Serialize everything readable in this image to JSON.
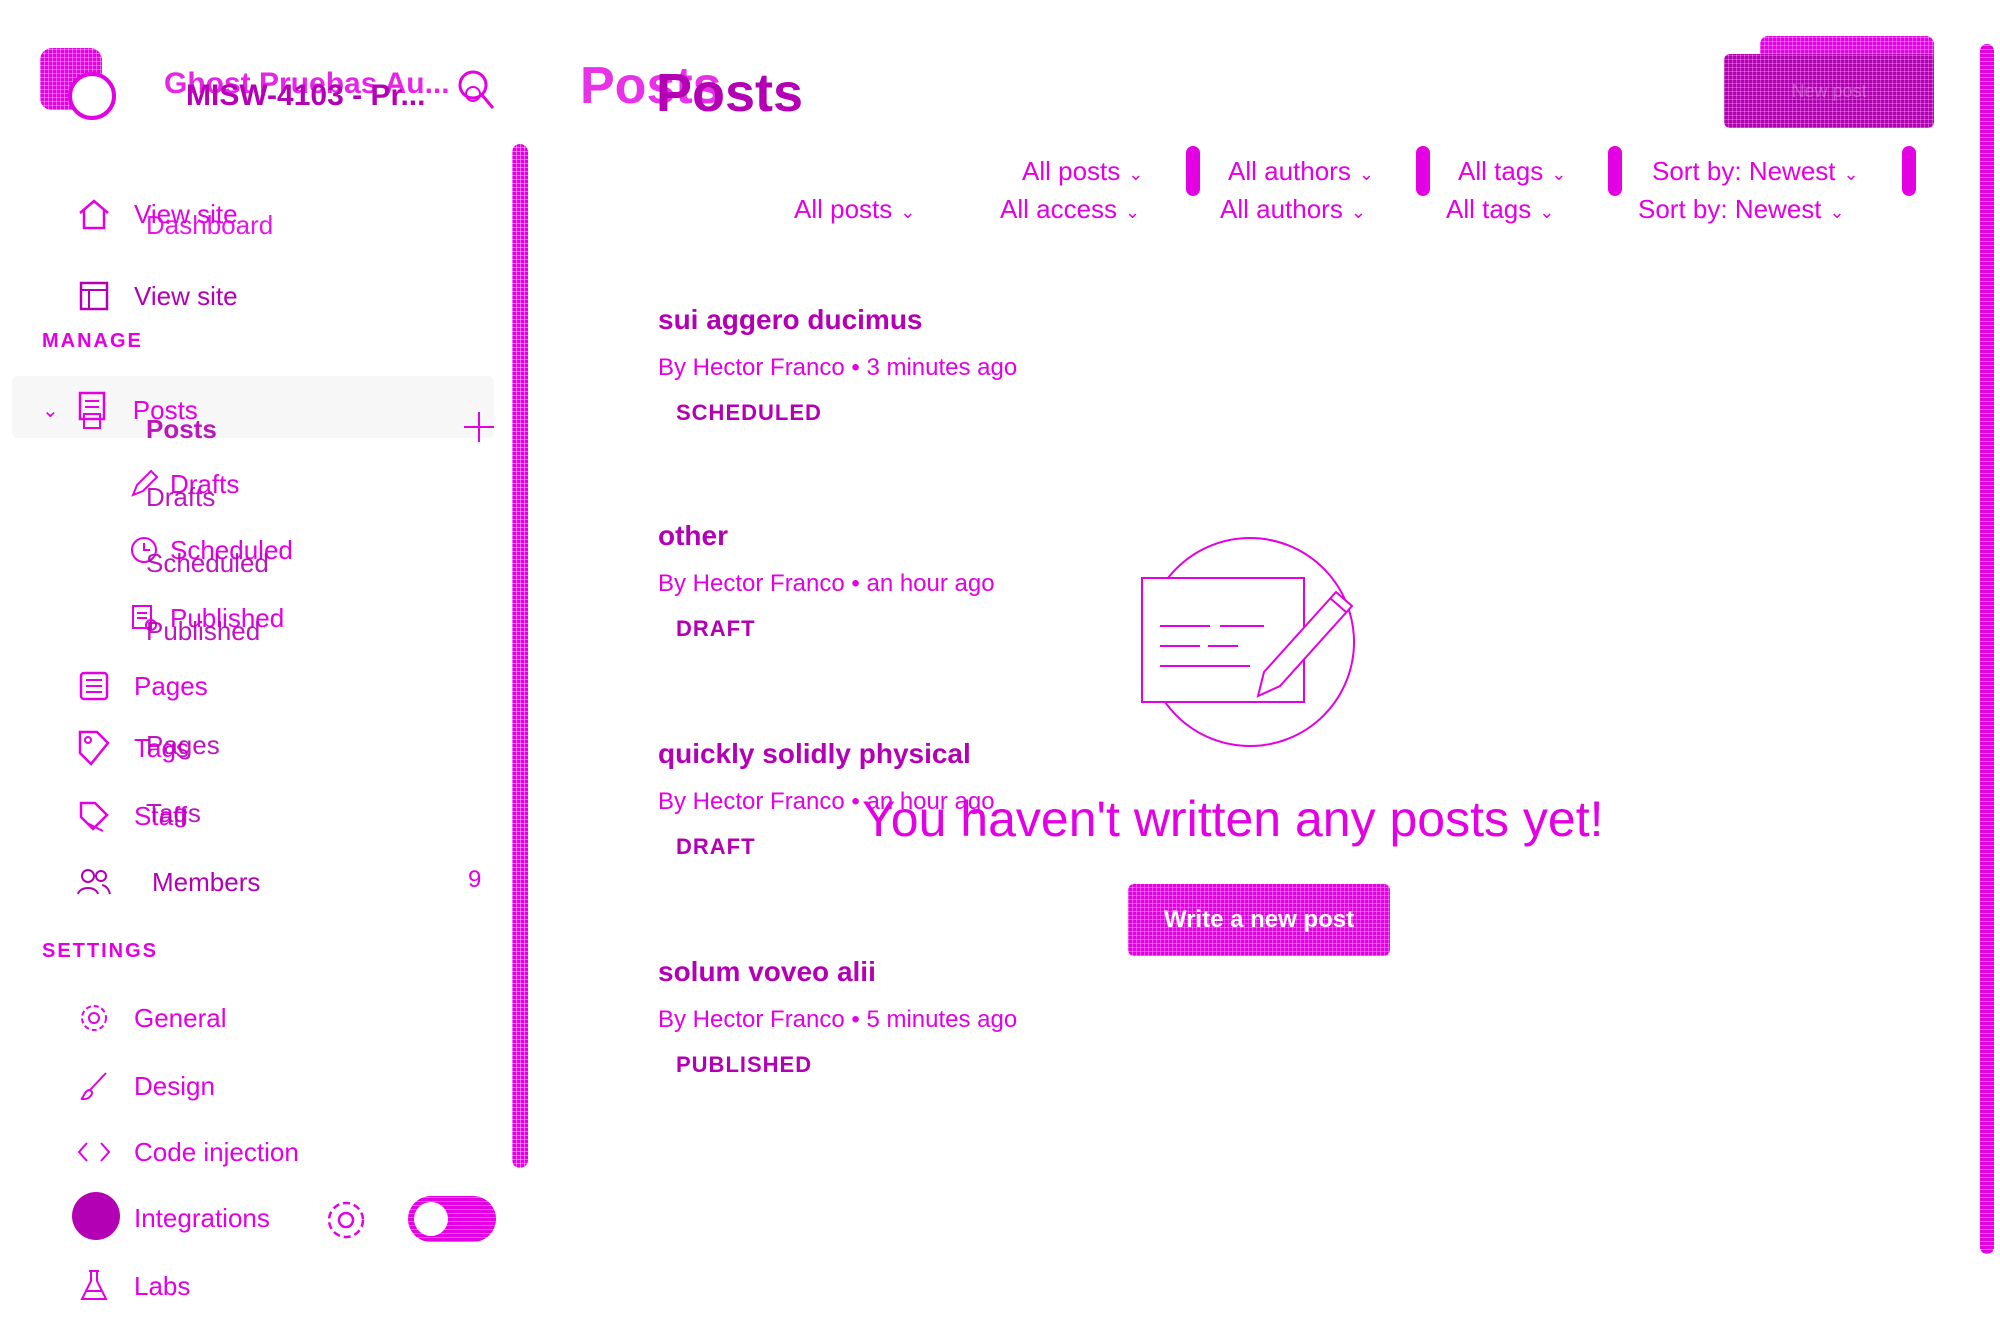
{
  "sidebar": {
    "site_title": "Ghost Pruebas Au...",
    "site_title_overlay": "MISW-4103 - Pr...",
    "nav_top": [
      {
        "label": "View site",
        "ghost": "Dashboard"
      },
      {
        "label": "View site"
      }
    ],
    "manage_label": "MANAGE",
    "posts_label": "Posts",
    "posts_label_overlay": "Posts",
    "posts_sub": [
      {
        "label": "Drafts",
        "overlay": "Drafts"
      },
      {
        "label": "Scheduled",
        "overlay": "Scheduled"
      },
      {
        "label": "Published",
        "overlay": "Published"
      }
    ],
    "pages_label": "Pages",
    "tags_label": "Tags",
    "tags_overlay": "Pages",
    "staff_label": "Staff",
    "staff_overlay": "Tags",
    "members_label": "Members",
    "members_count": "9",
    "settings_label": "SETTINGS",
    "general_label": "General",
    "design_label": "Design",
    "code_injection_label": "Code injection",
    "integrations_label": "Integrations",
    "labs_label": "Labs"
  },
  "main": {
    "title_ghost": "Posts",
    "title": "Posts",
    "new_post_label": "New post",
    "filters_top": [
      "All posts",
      "All authors",
      "All tags",
      "Sort by: Newest"
    ],
    "filters": [
      "All posts",
      "All access",
      "All authors",
      "All tags",
      "Sort by: Newest"
    ],
    "posts": [
      {
        "title": "sui aggero ducimus",
        "meta": "By Hector Franco • 3 minutes ago",
        "status": "SCHEDULED"
      },
      {
        "title": "other",
        "meta": "By Hector Franco • an hour ago",
        "status": "DRAFT"
      },
      {
        "title": "quickly solidly physical",
        "meta": "By Hector Franco • an hour ago",
        "status": "DRAFT"
      },
      {
        "title": "solum voveo alii",
        "meta": "By Hector Franco • 5 minutes ago",
        "status": "PUBLISHED"
      }
    ],
    "empty_message": "You haven't written any posts yet!",
    "write_button": "Write a new post"
  },
  "colors": {
    "accent": "#e300e3",
    "accent_dark": "#b400b4"
  }
}
